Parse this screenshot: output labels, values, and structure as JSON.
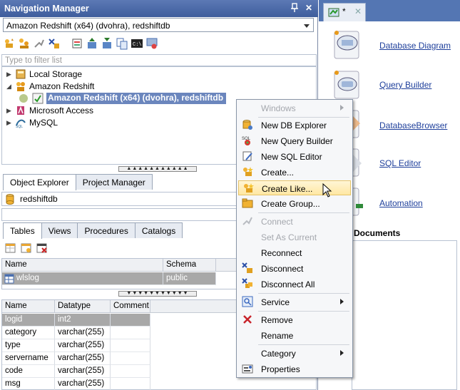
{
  "nav": {
    "title": "Navigation Manager",
    "connection": "Amazon Redshift (x64) (dvohra), redshiftdb",
    "filter_placeholder": "Type to filter list",
    "tree": [
      {
        "label": "Local Storage"
      },
      {
        "label": "Amazon Redshift"
      },
      {
        "label": "Amazon Redshift (x64) (dvohra), redshiftdb"
      },
      {
        "label": "Microsoft Access"
      },
      {
        "label": "MySQL"
      }
    ]
  },
  "object_explorer": {
    "tabs": [
      "Object Explorer",
      "Project Manager"
    ],
    "database": "redshiftdb",
    "sub_tabs": [
      "Tables",
      "Views",
      "Procedures",
      "Catalogs"
    ],
    "tables": {
      "columns": [
        "Name",
        "Schema"
      ],
      "rows": [
        [
          "wlslog",
          "public"
        ]
      ]
    },
    "details": {
      "columns": [
        "Name",
        "Datatype",
        "Comment"
      ],
      "rows": [
        [
          "logid",
          "int2",
          ""
        ],
        [
          "category",
          "varchar(255)",
          ""
        ],
        [
          "type",
          "varchar(255)",
          ""
        ],
        [
          "servername",
          "varchar(255)",
          ""
        ],
        [
          "code",
          "varchar(255)",
          ""
        ],
        [
          "msg",
          "varchar(255)",
          ""
        ]
      ]
    }
  },
  "editor": {
    "tab_label": "*",
    "quick_links": [
      "Database Diagram",
      "Query Builder",
      "DatabaseBrowser",
      "SQL Editor",
      "Automation"
    ],
    "documents_title": "Documents"
  },
  "context_menu": {
    "items": [
      {
        "label": "Windows"
      },
      {
        "label": "New DB Explorer"
      },
      {
        "label": "New Query Builder"
      },
      {
        "label": "New SQL Editor"
      },
      {
        "label": "Create..."
      },
      {
        "label": "Create Like..."
      },
      {
        "label": "Create Group..."
      },
      {
        "label": "Connect"
      },
      {
        "label": "Set As Current"
      },
      {
        "label": "Reconnect"
      },
      {
        "label": "Disconnect"
      },
      {
        "label": "Disconnect All"
      },
      {
        "label": "Service"
      },
      {
        "label": "Remove"
      },
      {
        "label": "Rename"
      },
      {
        "label": "Category"
      },
      {
        "label": "Properties"
      }
    ]
  },
  "colors": {
    "title_bar": "#4a68a8",
    "selection": "#6b86bd",
    "menu_hover": "#ffe7a3",
    "link": "#1e3f9b"
  }
}
